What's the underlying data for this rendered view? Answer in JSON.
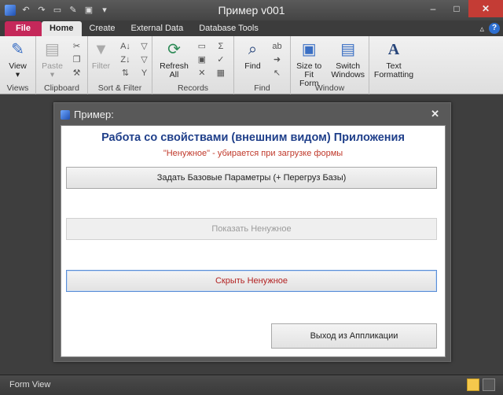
{
  "window": {
    "title": "Пример v001"
  },
  "tabs": [
    {
      "label": "File"
    },
    {
      "label": "Home"
    },
    {
      "label": "Create"
    },
    {
      "label": "External Data"
    },
    {
      "label": "Database Tools"
    }
  ],
  "ribbon": {
    "views": {
      "view_label": "View",
      "group_label": "Views"
    },
    "clipboard": {
      "paste_label": "Paste",
      "group_label": "Clipboard"
    },
    "sort_filter": {
      "filter_label": "Filter",
      "group_label": "Sort & Filter"
    },
    "records": {
      "refresh_label": "Refresh\nAll",
      "group_label": "Records"
    },
    "find": {
      "find_label": "Find",
      "group_label": "Find"
    },
    "window": {
      "size_label": "Size to\nFit Form",
      "switch_label": "Switch\nWindows",
      "group_label": "Window"
    },
    "text": {
      "formatting_label": "Text\nFormatting"
    }
  },
  "form": {
    "title": "Пример:",
    "heading": "Работа со свойствами (внешним видом) Приложения",
    "subheading": "\"Ненужное\" - убирается при загрузке формы",
    "buttons": {
      "set_params": "Задать Базовые Параметры (+ Перегруз Базы)",
      "show_hidden": "Показать Ненужное",
      "hide": "Скрыть Ненужное",
      "exit": "Выход из Аппликации"
    }
  },
  "status": {
    "view": "Form View"
  }
}
